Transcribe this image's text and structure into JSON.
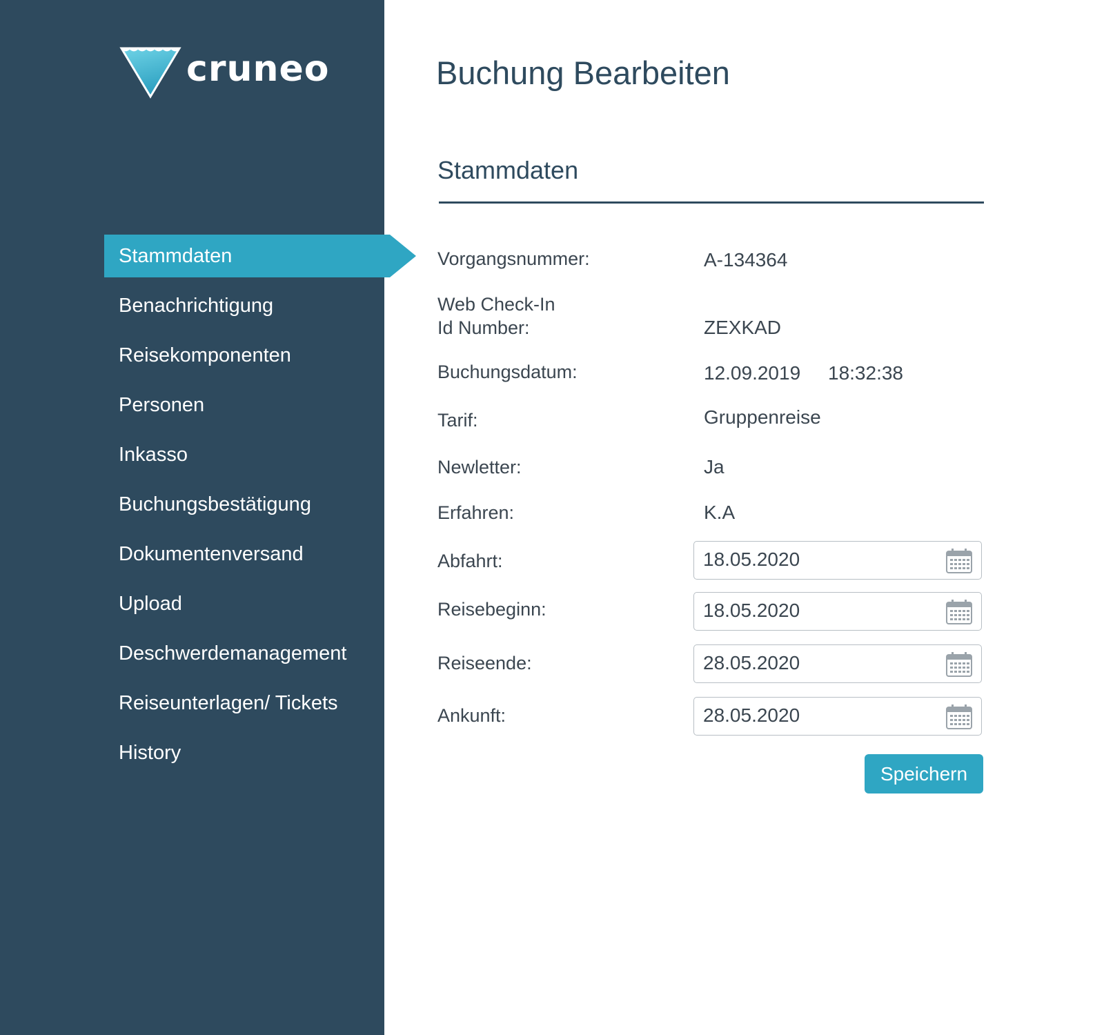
{
  "brand": {
    "name": "cruneo"
  },
  "sidebar": {
    "items": [
      {
        "label": "Stammdaten",
        "active": true
      },
      {
        "label": "Benachrichtigung"
      },
      {
        "label": "Reisekomponenten"
      },
      {
        "label": "Personen"
      },
      {
        "label": "Inkasso"
      },
      {
        "label": "Buchungsbestätigung"
      },
      {
        "label": "Dokumentenversand"
      },
      {
        "label": "Upload"
      },
      {
        "label": "Deschwerdemanagement"
      },
      {
        "label": "Reiseunterlagen/ Tickets"
      },
      {
        "label": "History"
      }
    ]
  },
  "page": {
    "title": "Buchung Bearbeiten"
  },
  "section": {
    "title": "Stammdaten"
  },
  "fields": {
    "vorgangsnummer": {
      "label": "Vorgangsnummer:",
      "value": "A-134364"
    },
    "webcheckin": {
      "label_line1": "Web Check-In",
      "label_line2": "Id Number:",
      "value": "ZEXKAD"
    },
    "buchungsdatum": {
      "label": "Buchungsdatum:",
      "date": "12.09.2019",
      "time": "18:32:38"
    },
    "tarif": {
      "label": "Tarif:",
      "value": "Gruppenreise"
    },
    "newsletter": {
      "label": "Newletter:",
      "value": "Ja"
    },
    "erfahren": {
      "label": "Erfahren:",
      "value": "K.A"
    },
    "abfahrt": {
      "label": "Abfahrt:",
      "value": "18.05.2020"
    },
    "reisebeginn": {
      "label": "Reisebeginn:",
      "value": "18.05.2020"
    },
    "reiseende": {
      "label": "Reiseende:",
      "value": "28.05.2020"
    },
    "ankunft": {
      "label": "Ankunft:",
      "value": "28.05.2020"
    }
  },
  "actions": {
    "save_label": "Speichern"
  },
  "icons": {
    "date_picker": "calendar-icon",
    "logo": "triangle-logo-icon"
  },
  "colors": {
    "sidebar_bg": "#2e4a5e",
    "accent": "#2fa6c3",
    "text": "#3b4650"
  }
}
